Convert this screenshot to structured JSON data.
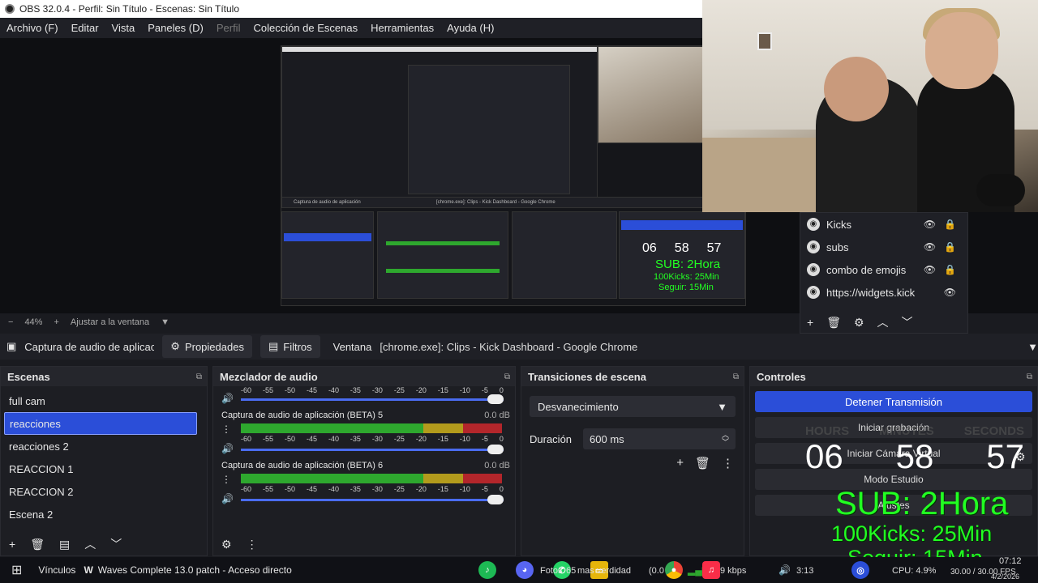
{
  "window": {
    "title": "OBS 32.0.4 - Perfil: Sin Título - Escenas: Sin Título"
  },
  "menu": [
    "Archivo (F)",
    "Editar",
    "Vista",
    "Paneles (D)",
    "Perfil",
    "Colección de Escenas",
    "Herramientas",
    "Ayuda (H)"
  ],
  "nested_preview": {
    "source_bar": [
      "Captura de audio de aplicación",
      "Propiedades",
      "Filtros",
      "Ventana",
      "[chrome.exe]: Clips - Kick Dashboard - Google Chrome"
    ],
    "timer": [
      "06",
      "58",
      "57"
    ],
    "sub": "SUB: 2Hora",
    "kicks": "100Kicks: 25Min",
    "seguir": "Seguir: 15Min"
  },
  "zoom": {
    "minus": "−",
    "value": "44%",
    "plus": "+",
    "fit": "Ajustar a la ventana"
  },
  "sources": {
    "items": [
      {
        "label": "Kicks"
      },
      {
        "label": "subs"
      },
      {
        "label": "combo de emojis"
      },
      {
        "label": "https://widgets.kick"
      }
    ]
  },
  "source_toolbar": {
    "name": "Captura de audio de aplicac",
    "properties": "Propiedades",
    "filters": "Filtros",
    "window_label": "Ventana",
    "window_value": "[chrome.exe]: Clips - Kick Dashboard - Google Chrome"
  },
  "scenes": {
    "title": "Escenas",
    "items": [
      "full cam",
      "reacciones",
      "reacciones 2",
      "REACCION 1",
      "REACCION  2",
      "Escena 2"
    ],
    "selected": "reacciones"
  },
  "mixer": {
    "title": "Mezclador de audio",
    "scale": [
      "-60",
      "-55",
      "-50",
      "-45",
      "-40",
      "-35",
      "-30",
      "-25",
      "-20",
      "-15",
      "-10",
      "-5",
      "0"
    ],
    "channels": [
      {
        "name": "Captura de audio de aplicación (BETA) 5",
        "db": "0.0 dB"
      },
      {
        "name": "Captura de audio de aplicación (BETA) 6",
        "db": "0.0 dB"
      }
    ]
  },
  "transitions": {
    "title": "Transiciones de escena",
    "selected": "Desvanecimiento",
    "duration_label": "Duración",
    "duration_value": "600 ms"
  },
  "controls": {
    "title": "Controles",
    "stop_stream": "Detener Transmisión",
    "start_record": "Iniciar grabación",
    "virtual_cam": "Iniciar Cámara Virtual",
    "studio_mode": "Modo Estudio",
    "settings": "Ajustes"
  },
  "overlay": {
    "timer_labels": [
      "HOURS",
      "MINUTES",
      "SECONDS"
    ],
    "timer": [
      "06",
      "58",
      "57"
    ],
    "sub": "SUB: 2Hora",
    "kicks": "100Kicks: 25Min",
    "seguir": "Seguir: 15Min"
  },
  "taskbar": {
    "vinculos": "Vínculos",
    "shortcut": "Waves Complete 13.0 patch - Acceso directo",
    "app1": "Fotos",
    "badge": "65",
    "app2": "mas verdidad",
    "net": "(0.0",
    "kbps": "9 kbps",
    "time_small": "3:13",
    "cpu": "CPU: 4.9%",
    "fps": "30.00 / 30.00 FPS",
    "clock": "07:12",
    "date": "4/2/2026"
  },
  "colors": {
    "accent": "#2b4ed8",
    "overlay_green": "#22ff22",
    "meter_green": "#2ea82e",
    "meter_yellow": "#b39b1c",
    "meter_red": "#b3262b"
  }
}
